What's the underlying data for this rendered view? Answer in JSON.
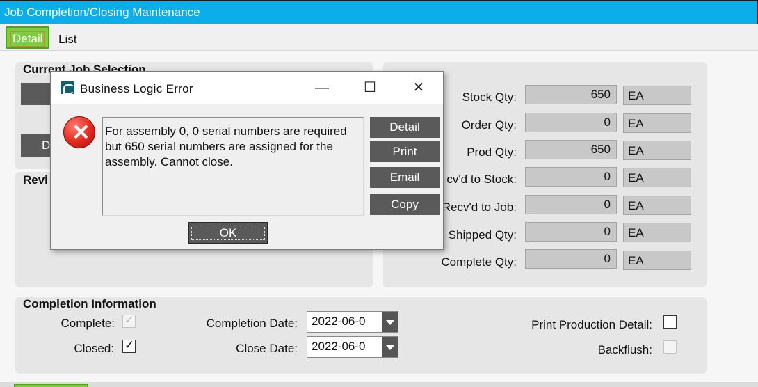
{
  "window": {
    "title": "Job Completion/Closing Maintenance"
  },
  "tabs": [
    {
      "label": "Detail",
      "active": true
    },
    {
      "label": "List",
      "active": false
    }
  ],
  "current_job": {
    "title": "Current Job Selection",
    "partial_button_label": "D"
  },
  "revision": {
    "title_partial": "Revi"
  },
  "quantities": [
    {
      "label": "Stock Qty:",
      "value": "650",
      "uom": "EA"
    },
    {
      "label": "Order Qty:",
      "value": "0",
      "uom": "EA"
    },
    {
      "label": "Prod Qty:",
      "value": "650",
      "uom": "EA"
    },
    {
      "label": "cv'd to Stock:",
      "value": "0",
      "uom": "EA"
    },
    {
      "label": "Recv'd to Job:",
      "value": "0",
      "uom": "EA"
    },
    {
      "label": "Shipped Qty:",
      "value": "0",
      "uom": "EA"
    },
    {
      "label": "Complete Qty:",
      "value": "0",
      "uom": "EA"
    }
  ],
  "completion": {
    "title": "Completion Information",
    "complete_label": "Complete:",
    "closed_label": "Closed:",
    "completion_date_label": "Completion Date:",
    "completion_date_value": "2022-06-0",
    "close_date_label": "Close Date:",
    "close_date_value": "2022-06-0",
    "print_detail_label": "Print Production Detail:",
    "backflush_label": "Backflush:",
    "complete_checked": true,
    "closed_checked": true,
    "print_detail_checked": false,
    "backflush_checked": false
  },
  "dialog": {
    "title": "Business Logic Error",
    "message": "For assembly 0, 0 serial numbers are required but 650 serial numbers are assigned for the assembly. Cannot close.",
    "buttons": {
      "detail": "Detail",
      "print": "Print",
      "email": "Email",
      "copy": "Copy",
      "ok": "OK"
    },
    "controls": {
      "minimize": "—",
      "maximize": "☐",
      "close": "✕"
    }
  },
  "colors": {
    "title_bar": "#0aaee8",
    "active_tab": "#7ccf3c",
    "dark_button": "#5a5a5a",
    "error_red": "#e3271d"
  },
  "icons": [
    "app-logo-icon",
    "error-icon",
    "dropdown-arrow-icon",
    "checkmark-icon"
  ]
}
